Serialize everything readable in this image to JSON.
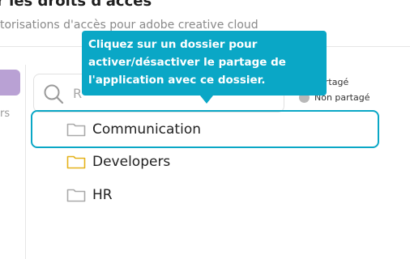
{
  "header": {
    "title": "r les droits d'accès",
    "subtitle": "torisations d'accès pour adobe creative cloud"
  },
  "sidebar": {
    "partial_text": "rs"
  },
  "search": {
    "placeholder": "R"
  },
  "legend": {
    "items": [
      {
        "label": "Partagé",
        "color": "#0aa7c6"
      },
      {
        "label": "Non partagé",
        "color": "#b8b8b8"
      }
    ]
  },
  "tooltip": {
    "text": "Cliquez sur un dossier pour activer/désactiver le partage de l'application avec ce dossier."
  },
  "folders": [
    {
      "label": "Communication",
      "icon": "folder-icon",
      "color": "#a9a9a9",
      "highlighted": true
    },
    {
      "label": "Developers",
      "icon": "folder-icon",
      "color": "#e5b21a",
      "highlighted": false
    },
    {
      "label": "HR",
      "icon": "folder-icon",
      "color": "#a9a9a9",
      "highlighted": false
    }
  ],
  "colors": {
    "accent": "#0aa7c6",
    "sidebar_pill": "#b9a1d4"
  }
}
